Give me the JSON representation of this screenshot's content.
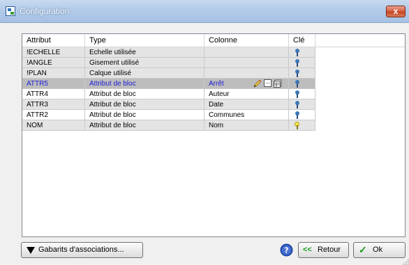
{
  "window": {
    "title": "Configuration",
    "close_label": "x"
  },
  "grid": {
    "columns": [
      "Attribut",
      "Type",
      "Colonne",
      "Clé"
    ],
    "rows": [
      {
        "attribut": "!ECHELLE",
        "type": "Echelle utilisée",
        "colonne": "",
        "cle": "blue-key"
      },
      {
        "attribut": "!ANGLE",
        "type": "Gisement utilisé",
        "colonne": "",
        "cle": "blue-key"
      },
      {
        "attribut": "!PLAN",
        "type": "Calque utilisé",
        "colonne": "",
        "cle": "blue-key"
      },
      {
        "attribut": "ATTR5",
        "type": "Attribut de bloc",
        "colonne": "Arrêt",
        "cle": "blue-key",
        "selected": true
      },
      {
        "attribut": "ATTR4",
        "type": "Attribut de bloc",
        "colonne": "Auteur",
        "cle": "blue-key"
      },
      {
        "attribut": "ATTR3",
        "type": "Attribut de bloc",
        "colonne": "Date",
        "cle": "blue-key"
      },
      {
        "attribut": "ATTR2",
        "type": "Attribut de bloc",
        "colonne": "Communes",
        "cle": "blue-key"
      },
      {
        "attribut": "NOM",
        "type": "Attribut de bloc",
        "colonne": "Nom",
        "cle": "yellow-key"
      }
    ]
  },
  "buttons": {
    "gabarits": "Gabarits d'associations...",
    "retour_arrows": "<<",
    "retour": "Retour",
    "ok_check": "✓",
    "ok": "Ok"
  },
  "colors": {
    "selected_text": "#1a1ad6",
    "row_grey": "#e4e4e4",
    "row_selected": "#bdbdbd"
  }
}
